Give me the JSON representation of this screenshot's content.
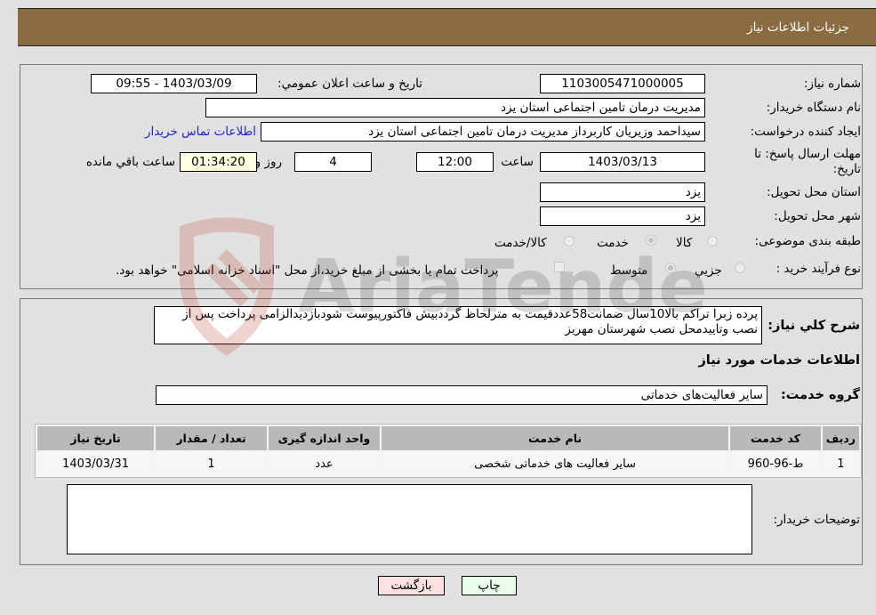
{
  "header": {
    "title": "جزئیات اطلاعات نیاز"
  },
  "form": {
    "need_number_label": "شماره نیاز:",
    "need_number": "1103005471000005",
    "announce_label": "تاريخ و ساعت اعلان عمومي:",
    "announce_value": "1403/03/09 - 09:55",
    "buyer_org_label": "نام دستگاه خریدار:",
    "buyer_org": "مدیریت درمان تامین اجتماعی استان یزد",
    "creator_label": "ایجاد کننده درخواست:",
    "creator": "سیداحمد وزیریان کاربرداز مدیریت درمان تامین اجتماعی استان یزد",
    "contact_link": "اطلاعات تماس خریدار",
    "deadline_label": "مهلت ارسال پاسخ: تا تاریخ:",
    "deadline_date": "1403/03/13",
    "time_label": "ساعت",
    "deadline_time": "12:00",
    "days_value": "4",
    "days_label": "روز و",
    "remaining_time": "01:34:20",
    "remaining_label": "ساعت باقي مانده",
    "province_label": "استان محل تحویل:",
    "province": "یزد",
    "city_label": "شهر محل تحویل:",
    "city": "یزد",
    "category_label": "طبقه بندی موضوعی:",
    "category_options": [
      {
        "label": "کالا",
        "selected": false
      },
      {
        "label": "خدمت",
        "selected": true
      },
      {
        "label": "کالا/خدمت",
        "selected": false
      }
    ],
    "process_label": "نوع فرآیند خرید :",
    "process_options": [
      {
        "label": "جزيي",
        "selected": false
      },
      {
        "label": "متوسط",
        "selected": true
      }
    ],
    "treasury_note": "پرداخت تمام یا بخشی از مبلغ خرید،از محل \"اسناد خزانه اسلامی\" خواهد بود.",
    "treasury_checked": false
  },
  "details": {
    "summary_label": "شرح كلي نياز:",
    "summary": "پرده زبرا تراکم بالا10سال ضمانت58عددقیمت به مترلحاظ گرددبیش فاکتورپیوست شودبازدیدالزامی پرداخت پس از نصب وتاییدمحل نصب شهرستان مهریز",
    "services_heading": "اطلاعات خدمات مورد نياز",
    "service_group_label": "گروه خدمت:",
    "service_group": "سایر فعالیت‌های خدماتی",
    "table": {
      "headers": [
        "ردیف",
        "کد خدمت",
        "نام خدمت",
        "واحد اندازه گیری",
        "تعداد / مقدار",
        "تاریخ نیاز"
      ],
      "rows": [
        [
          "1",
          "ط-96-960",
          "سایر فعالیت های خدماتی شخصی",
          "عدد",
          "1",
          "1403/03/31"
        ]
      ]
    },
    "buyer_notes_label": "توضیحات خریدار:",
    "buyer_notes": ""
  },
  "buttons": {
    "print": "چاپ",
    "back": "بازگشت"
  },
  "watermark": "AriaTender.net",
  "colors": {
    "header_bg": "#8b6b41",
    "print_bg": "#eaffea",
    "back_bg": "#ffe0e0",
    "link": "#2222cc"
  }
}
